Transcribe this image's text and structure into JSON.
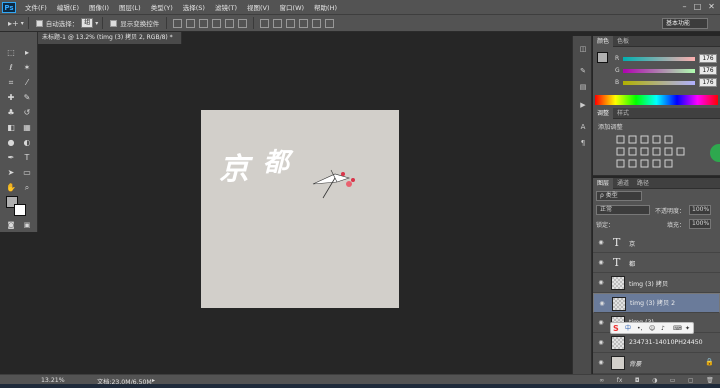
{
  "menubar": {
    "logo": "Ps",
    "items": [
      "文件(F)",
      "编辑(E)",
      "图像(I)",
      "图层(L)",
      "类型(Y)",
      "选择(S)",
      "滤镜(T)",
      "视图(V)",
      "窗口(W)",
      "帮助(H)"
    ]
  },
  "options_bar": {
    "auto_select_label": "自动选择：",
    "auto_select_value": "组",
    "show_transform_label": "显示变换控件",
    "workspace": "基本功能"
  },
  "document": {
    "tab_title": "未标题-1 @ 13.2% (timg (3) 拷贝 2, RGB/8) *",
    "close": "×"
  },
  "artwork": {
    "text_chars": [
      "京",
      "都"
    ],
    "background": "#d2cfca"
  },
  "status": {
    "zoom": "13.21%",
    "doc_size": "文档:23.0M/6.50M"
  },
  "color_panel": {
    "tabs": [
      "颜色",
      "色板"
    ],
    "channels": [
      {
        "label": "R",
        "value": "176"
      },
      {
        "label": "G",
        "value": "176"
      },
      {
        "label": "B",
        "value": "176"
      }
    ],
    "foreground": "#b0b0b0"
  },
  "adjust_panel": {
    "tabs": [
      "调整",
      "样式"
    ],
    "title": "添加调整"
  },
  "layers_panel": {
    "tabs": [
      "图层",
      "通道",
      "路径"
    ],
    "kind_label": "ρ 类型",
    "blend_mode": "正常",
    "opacity_label": "不透明度：",
    "opacity_value": "100%",
    "lock_label": "锁定：",
    "fill_label": "填充：",
    "fill_value": "100%",
    "layers": [
      {
        "name": "京",
        "kind": "text"
      },
      {
        "name": "都",
        "kind": "text"
      },
      {
        "name": "timg (3) 拷贝",
        "kind": "image"
      },
      {
        "name": "timg (3) 拷贝 2",
        "kind": "image",
        "selected": true
      },
      {
        "name": "timg (3)",
        "kind": "image"
      },
      {
        "name": "234731-14010PH24450",
        "kind": "image"
      },
      {
        "name": "背景",
        "kind": "image"
      }
    ]
  }
}
